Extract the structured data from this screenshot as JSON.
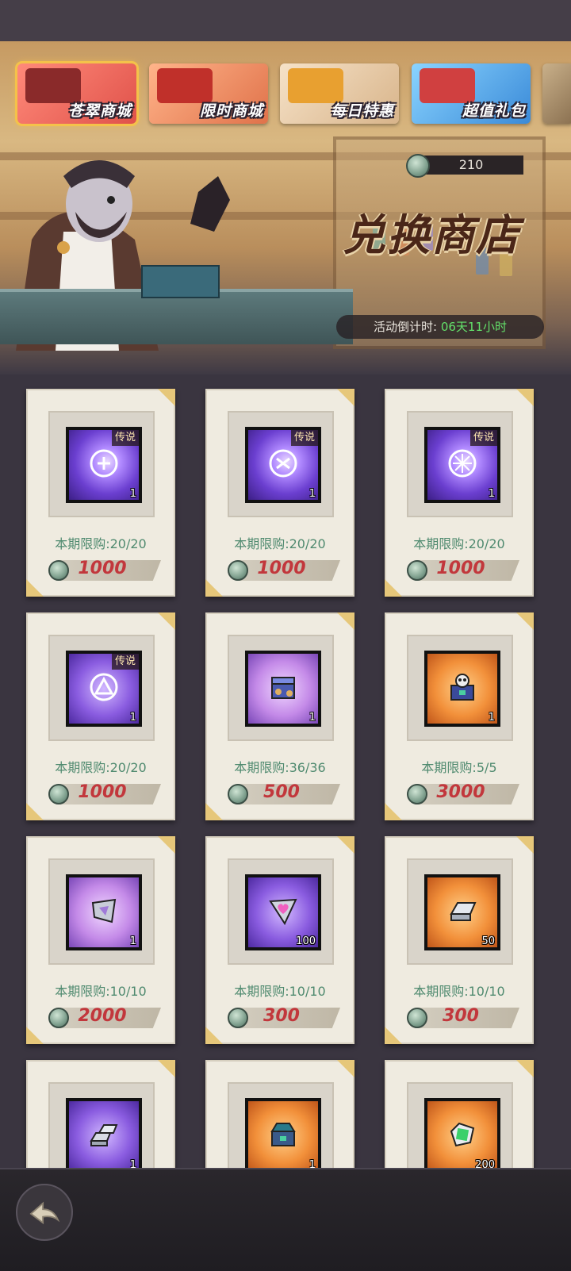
{
  "tabs": [
    {
      "label": "苍翠商城",
      "active": true,
      "icon": "gift-shop-icon"
    },
    {
      "label": "限时商城",
      "active": false,
      "icon": "treasure-chest-icon"
    },
    {
      "label": "每日特惠",
      "active": false,
      "icon": "shopping-bag-icon"
    },
    {
      "label": "超值礼包",
      "active": false,
      "icon": "robot-gift-icon"
    }
  ],
  "currency": {
    "value": "210",
    "icon": "green-token-icon"
  },
  "shop_title": "兑换商店",
  "countdown": {
    "label": "活动倒计时:",
    "time": "06天11小时"
  },
  "items": [
    {
      "tag": "传说",
      "qty": "1",
      "limit": "本期限购:20/20",
      "price": "1000",
      "icon": "legendary-rune-icon"
    },
    {
      "tag": "传说",
      "qty": "1",
      "limit": "本期限购:20/20",
      "price": "1000",
      "icon": "legendary-rune-icon"
    },
    {
      "tag": "传说",
      "qty": "1",
      "limit": "本期限购:20/20",
      "price": "1000",
      "icon": "legendary-rune-icon"
    },
    {
      "tag": "传说",
      "qty": "1",
      "limit": "本期限购:20/20",
      "price": "1000",
      "icon": "legendary-rune-icon"
    },
    {
      "tag": "",
      "qty": "1",
      "limit": "本期限购:36/36",
      "price": "500",
      "icon": "puzzle-chest-icon"
    },
    {
      "tag": "",
      "qty": "1",
      "limit": "本期限购:5/5",
      "price": "3000",
      "icon": "monster-chest-icon"
    },
    {
      "tag": "",
      "qty": "1",
      "limit": "本期限购:10/10",
      "price": "2000",
      "icon": "crystal-shard-icon"
    },
    {
      "tag": "",
      "qty": "100",
      "limit": "本期限购:10/10",
      "price": "300",
      "icon": "heart-shard-icon"
    },
    {
      "tag": "",
      "qty": "50",
      "limit": "本期限购:10/10",
      "price": "300",
      "icon": "silver-ingot-icon"
    },
    {
      "tag": "",
      "qty": "1",
      "limit": "",
      "price": "",
      "icon": "silver-ingot-stack-icon"
    },
    {
      "tag": "",
      "qty": "1",
      "limit": "",
      "price": "",
      "icon": "orange-chest-icon"
    },
    {
      "tag": "",
      "qty": "200",
      "limit": "",
      "price": "",
      "icon": "green-gem-frame-icon"
    }
  ],
  "colors": {
    "accent_gold": "#f4c24a",
    "price_red": "#c2373c",
    "limit_green": "#4f8a6f",
    "countdown_green": "#63e06a"
  }
}
